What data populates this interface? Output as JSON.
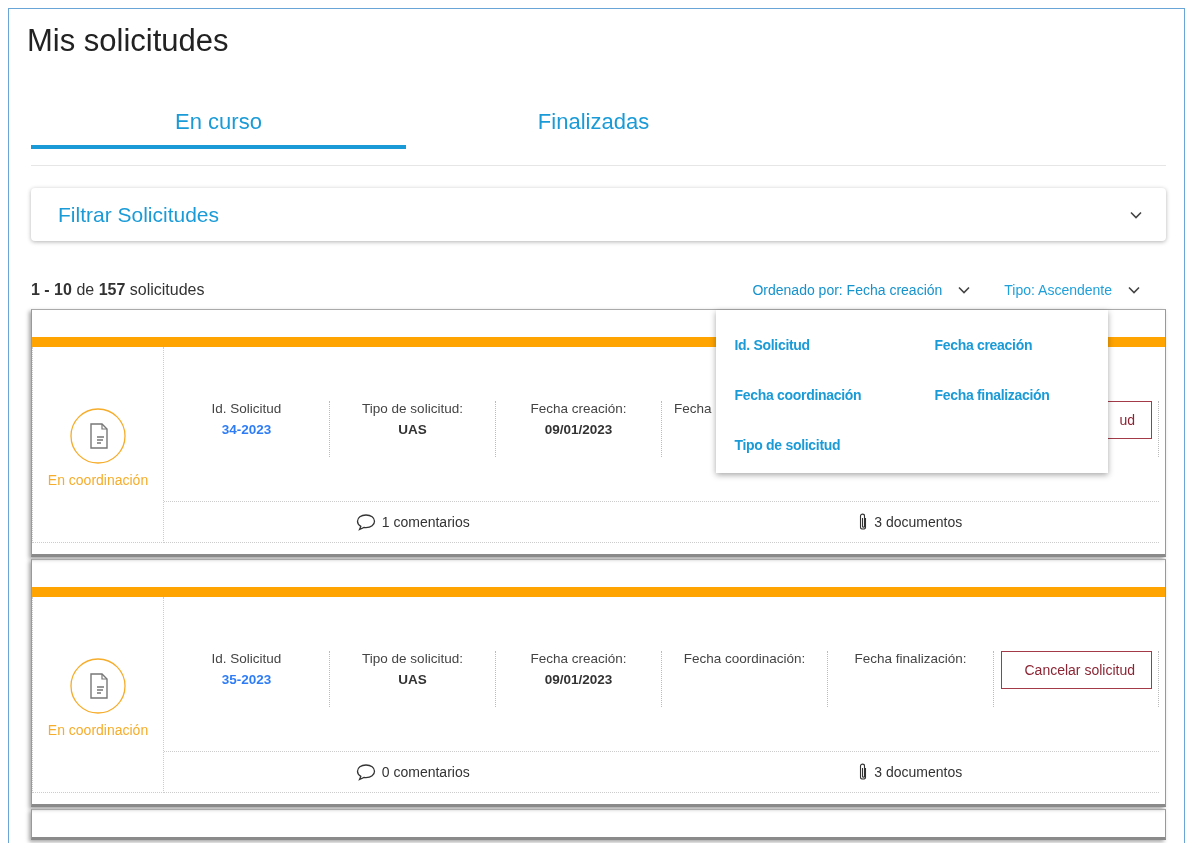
{
  "page": {
    "title": "Mis solicitudes"
  },
  "tabs": [
    {
      "label": "En curso",
      "selected": true
    },
    {
      "label": "Finalizadas",
      "selected": false
    }
  ],
  "filter_panel": {
    "title": "Filtrar Solicitudes",
    "expanded": false
  },
  "results": {
    "count_parts": [
      {
        "text": "1 - 10",
        "bold": true
      },
      {
        "text": "de",
        "bold": false
      },
      {
        "text": "157",
        "bold": true
      },
      {
        "text": "solicitudes",
        "bold": false
      }
    ]
  },
  "sort": {
    "label": "Ordenado por: Fecha creación",
    "expanded": true,
    "options": [
      "Id. Solicitud",
      "Fecha creación",
      "Fecha coordinación",
      "Fecha finalización",
      "Tipo de solicitud"
    ]
  },
  "order": {
    "label": "Tipo: Ascendente",
    "expanded": false
  },
  "cards": [
    {
      "status": "En coordinación",
      "fields": [
        {
          "label": "Id. Solicitud",
          "value": "34-2023",
          "kind": "link"
        },
        {
          "label": "Tipo de solicitud:",
          "value": "UAS",
          "kind": "text"
        },
        {
          "label": "Fecha creación:",
          "value": "09/01/2023",
          "kind": "text"
        },
        {
          "label": "Fecha",
          "kind": "cut"
        }
      ],
      "button": "ud",
      "comments": "1 comentarios",
      "documents": "3 documentos"
    },
    {
      "status": "En coordinación",
      "fields": [
        {
          "label": "Id. Solicitud",
          "value": "35-2023",
          "kind": "link"
        },
        {
          "label": "Tipo de solicitud:",
          "value": "UAS",
          "kind": "text"
        },
        {
          "label": "Fecha creación:",
          "value": "09/01/2023",
          "kind": "text"
        },
        {
          "label": "Fecha coordinación:",
          "kind": "label"
        },
        {
          "label": "Fecha finalización:",
          "kind": "label"
        }
      ],
      "button": "Cancelar solicitud",
      "comments": "0 comentarios",
      "documents": "3 documentos"
    }
  ]
}
